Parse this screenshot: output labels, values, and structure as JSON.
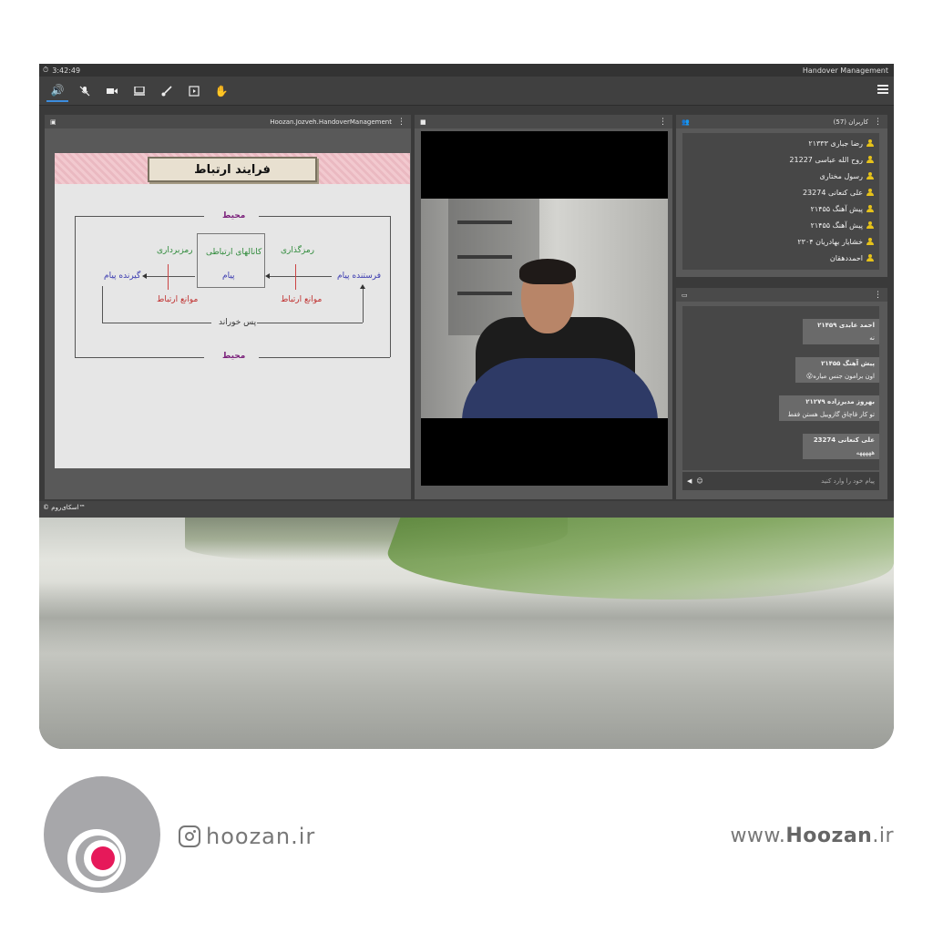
{
  "window": {
    "clock": "3:42:49",
    "title": "Handover Management"
  },
  "toolbar": {
    "icons": [
      "speaker-icon",
      "mic-off-icon",
      "camera-icon",
      "screen-share-icon",
      "brush-icon",
      "media-icon",
      "raise-hand-icon",
      "menu-icon"
    ]
  },
  "presentation": {
    "file_name": "Hoozan.Jozveh.HandoverManagement",
    "slide": {
      "title": "فرایند ارتباط",
      "env_top": "محیط",
      "env_bottom": "محیط",
      "encoding": "رمزگذاری",
      "decoding": "رمزبرداری",
      "channels": "کانالهای ارتباطی",
      "message": "پیام",
      "sender": "فرستنده پیام",
      "receiver": "گیرنده پیام",
      "barriers_left": "موانع ارتباط",
      "barriers_right": "موانع ارتباط",
      "feedback": "پس خوراند"
    }
  },
  "users": {
    "header": "کاربران (57)",
    "list": [
      "رضا جباری ۲۱۳۳۳",
      "روح الله عباسی 21227",
      "رسول مختاری",
      "علی کنعانی 23274",
      "پیش آهنگ ۲۱۴۵۵",
      "پیش آهنگ ۲۱۴۵۵",
      "خشایار بهادریان ۲۳۰۴",
      "احمددهقان"
    ]
  },
  "chat": {
    "messages": [
      {
        "author": "احمد عابدی ۲۱۴۵۹",
        "text": "نه"
      },
      {
        "author": "پیش آهنگ ۲۱۴۵۵",
        "text": "اون برامون جنس میاره😮"
      },
      {
        "author": "بهروز مدیرزاده ۲۱۲۷۹",
        "text": "تو کار قاچاق گازوییل هستن فقط"
      },
      {
        "author": "علی کنعانی 23274",
        "text": "هههههه"
      }
    ],
    "input_placeholder": "پیام خود را وارد کنید"
  },
  "footer": {
    "copyright": "© اسکای‌روم™"
  },
  "brand": {
    "instagram": "hoozan.ir",
    "website_prefix": "www.",
    "website_name": "Hoozan",
    "website_suffix": ".ir",
    "accent": "#e6195a"
  }
}
